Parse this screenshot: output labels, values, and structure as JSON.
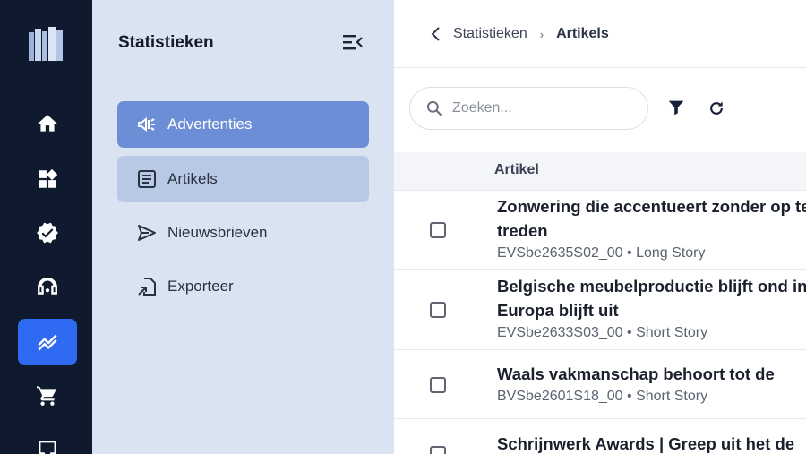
{
  "rail": {
    "items": [
      {
        "name": "home",
        "icon": "home-icon",
        "active": false
      },
      {
        "name": "widgets",
        "icon": "widgets-icon",
        "active": false
      },
      {
        "name": "verified",
        "icon": "verified-badge-icon",
        "active": false
      },
      {
        "name": "support",
        "icon": "headset-icon",
        "active": false
      },
      {
        "name": "statistics",
        "icon": "trending-chart-icon",
        "active": true
      },
      {
        "name": "shop",
        "icon": "shopping-cart-icon",
        "active": false
      },
      {
        "name": "inbox",
        "icon": "inbox-icon",
        "active": false
      }
    ],
    "active_color": "#2f6bf2",
    "background": "#0f1a2e"
  },
  "sidebar": {
    "title": "Statistieken",
    "items": [
      {
        "label": "Advertenties",
        "icon": "megaphone-icon",
        "state": "active"
      },
      {
        "label": "Artikels",
        "icon": "article-icon",
        "state": "selected"
      },
      {
        "label": "Nieuwsbrieven",
        "icon": "send-icon",
        "state": "normal"
      },
      {
        "label": "Exporteer",
        "icon": "export-file-icon",
        "state": "normal"
      }
    ]
  },
  "breadcrumb": {
    "parent": "Statistieken",
    "separator": "›",
    "current": "Artikels"
  },
  "search": {
    "placeholder": "Zoeken...",
    "value": ""
  },
  "table": {
    "column_header": "Artikel",
    "rows": [
      {
        "title": "Zonwering die accentueert zonder op te treden",
        "meta": "EVSbe2635S02_00 • Long Story",
        "checked": false
      },
      {
        "title": "Belgische meubelproductie blijft ond in Europa blijft uit",
        "meta": "EVSbe2633S03_00 • Short Story",
        "checked": false
      },
      {
        "title": "Waals vakmanschap behoort tot de",
        "meta": "BVSbe2601S18_00 • Short Story",
        "checked": false
      },
      {
        "title": "Schrijnwerk Awards | Greep uit het de",
        "meta": "",
        "checked": false
      }
    ]
  }
}
